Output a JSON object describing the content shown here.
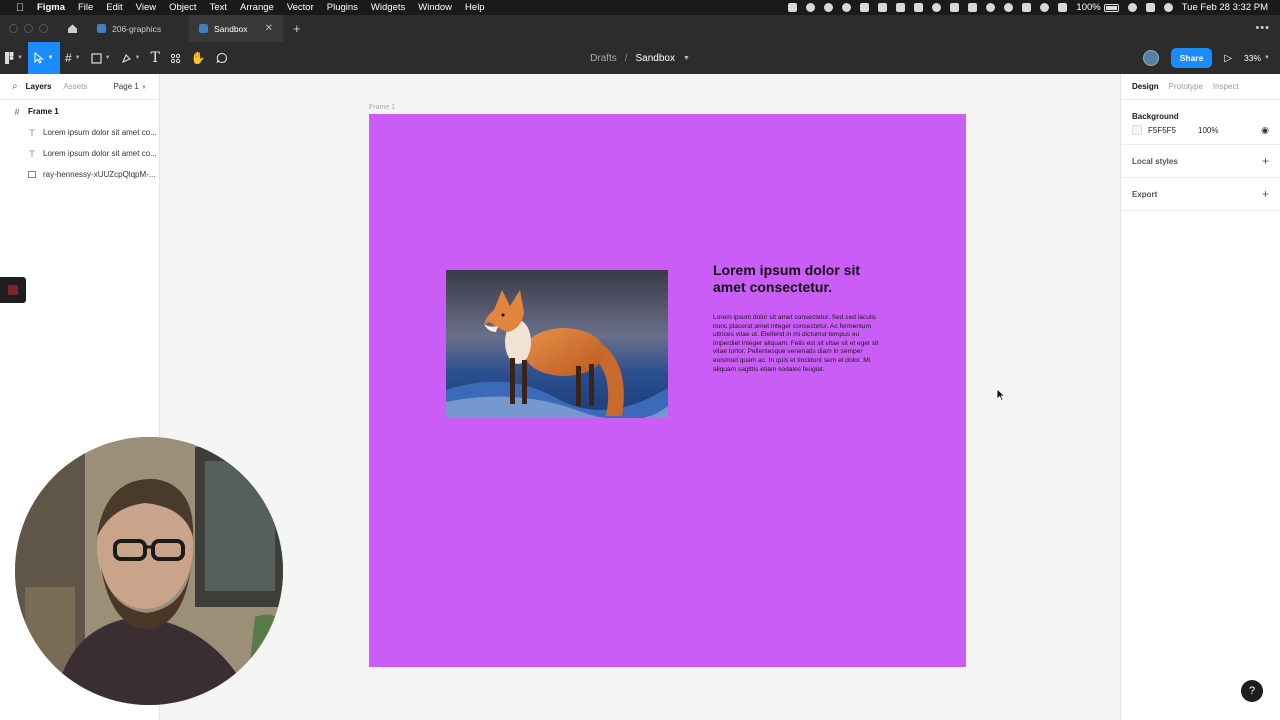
{
  "menubar": {
    "app_name": "Figma",
    "menus": [
      "File",
      "Edit",
      "View",
      "Object",
      "Text",
      "Arrange",
      "Vector",
      "Plugins",
      "Widgets",
      "Window",
      "Help"
    ],
    "battery": "100%",
    "clock": "Tue Feb 28  3:32 PM"
  },
  "tabs": [
    {
      "label": "206-graphics"
    },
    {
      "label": "Sandbox"
    }
  ],
  "toolbar": {
    "breadcrumb_parent": "Drafts",
    "breadcrumb_sep": "/",
    "file_name": "Sandbox",
    "share_label": "Share",
    "zoom": "33%"
  },
  "left_panel": {
    "tab_layers": "Layers",
    "tab_assets": "Assets",
    "page": "Page 1",
    "layers": [
      {
        "name": "Frame 1",
        "kind": "frame"
      },
      {
        "name": "Lorem ipsum dolor sit amet co...",
        "kind": "text"
      },
      {
        "name": "Lorem ipsum dolor sit amet co...",
        "kind": "text"
      },
      {
        "name": "ray-hennessy-xUUZcpQlqpM-...",
        "kind": "image"
      }
    ]
  },
  "canvas": {
    "frame_label": "Frame 1",
    "frame_fill": "#C95DF6",
    "heading": "Lorem ipsum dolor sit amet consectetur.",
    "body": "Lorem ipsum dolor sit amet consectetur. Sed sed iaculis nunc placerat amet integer consectetur. Ac fermentum ultrices vitae ut. Eleifend in mi dictumst tempus eu imperdiet integer aliquam. Felis est sit vitae sit et eget sit vitae tortor. Pellentesque venenatis diam in semper euismod quam ac. In quis et tincidunt sem et dolor. Mi aliquam sagittis etiam sodales feugiat.",
    "image_icon": "fox-photo"
  },
  "right_panel": {
    "tab_design": "Design",
    "tab_prototype": "Prototype",
    "tab_inspect": "Inspect",
    "background_title": "Background",
    "background_hex": "F5F5F5",
    "background_opacity": "100%",
    "local_styles": "Local styles",
    "export": "Export"
  },
  "colors": {
    "accent": "#1A8CFF",
    "toolbar_bg": "#2C2C2C",
    "canvas_bg": "#F5F5F5"
  }
}
